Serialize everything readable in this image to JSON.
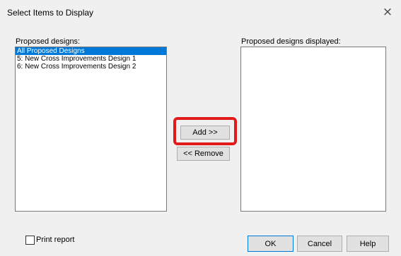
{
  "window": {
    "title": "Select Items to Display",
    "close_glyph": "×"
  },
  "left_panel": {
    "label": "Proposed designs:",
    "items": [
      {
        "label": "All Proposed Designs",
        "selected": true
      },
      {
        "label": "5: New Cross Improvements Design 1",
        "selected": false
      },
      {
        "label": "6: New Cross Improvements Design 2",
        "selected": false
      }
    ]
  },
  "right_panel": {
    "label": "Proposed designs displayed:",
    "items": []
  },
  "buttons": {
    "add_label": "Add >>",
    "remove_label": "<< Remove",
    "ok_label": "OK",
    "cancel_label": "Cancel",
    "help_label": "Help"
  },
  "print_report": {
    "label": "Print report",
    "checked": false
  },
  "colors": {
    "selection": "#0078d7",
    "highlight": "#e21a1a"
  }
}
